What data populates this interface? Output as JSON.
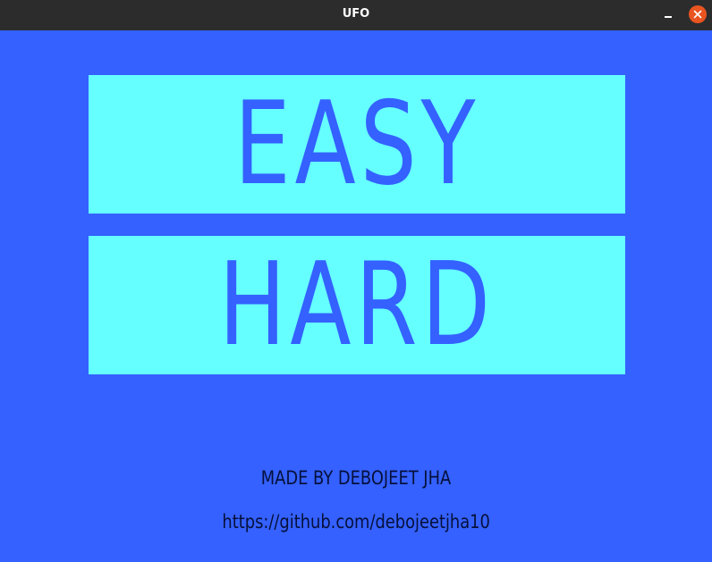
{
  "window": {
    "title": "UFO"
  },
  "menu": {
    "easy_label": "EASY",
    "hard_label": "HARD"
  },
  "footer": {
    "credit": "MADE BY DEBOJEET JHA",
    "link": "https://github.com/debojeetjha10"
  },
  "colors": {
    "background": "#3461ff",
    "button_fill": "#66ffff",
    "button_text": "#3461ff",
    "footer_text": "#06103a",
    "titlebar": "#2c2c2c",
    "close_button": "#e95420"
  },
  "icons": {
    "minimize": "minimize-icon",
    "close": "close-icon"
  }
}
